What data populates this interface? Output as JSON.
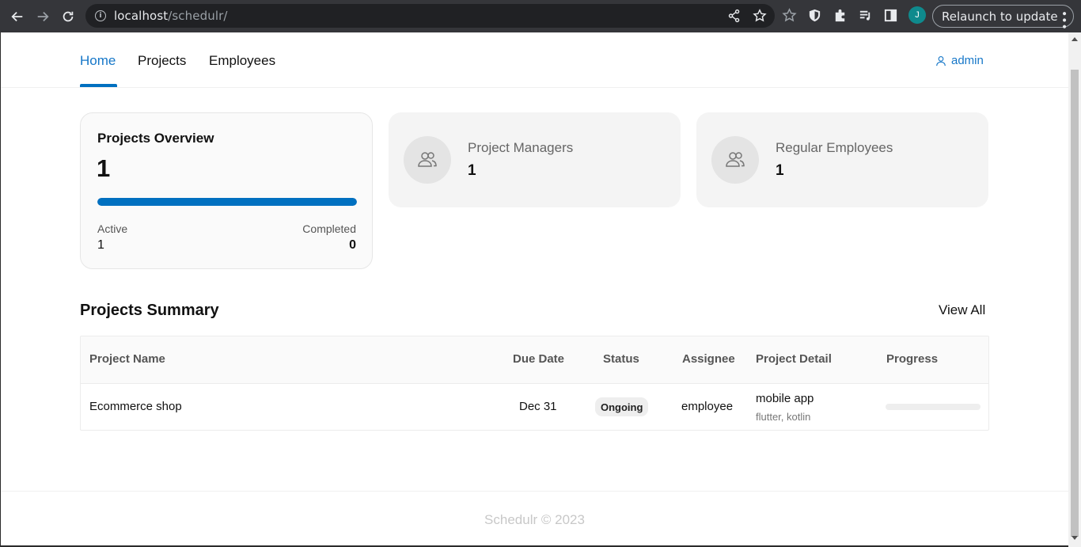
{
  "browser": {
    "url_host": "localhost",
    "url_path": "/schedulr/",
    "profile_initial": "J",
    "relaunch_label": "Relaunch to update"
  },
  "nav": {
    "items": [
      {
        "label": "Home",
        "active": true
      },
      {
        "label": "Projects",
        "active": false
      },
      {
        "label": "Employees",
        "active": false
      }
    ],
    "user": "admin"
  },
  "overview": {
    "title": "Projects Overview",
    "count": "1",
    "active_fraction": 1.0,
    "active_label": "Active",
    "active_value": "1",
    "completed_label": "Completed",
    "completed_value": "0"
  },
  "stats": [
    {
      "label": "Project Managers",
      "value": "1"
    },
    {
      "label": "Regular Employees",
      "value": "1"
    }
  ],
  "summary": {
    "title": "Projects Summary",
    "view_all": "View All",
    "columns": [
      "Project Name",
      "Due Date",
      "Status",
      "Assignee",
      "Project Detail",
      "Progress"
    ],
    "rows": [
      {
        "name": "Ecommerce shop",
        "due": "Dec 31",
        "status": "Ongoing",
        "assignee": "employee",
        "detail": "mobile app",
        "detail_sub": "flutter, kotlin",
        "progress": 0
      }
    ]
  },
  "footer": {
    "text": "Schedulr © 2023"
  },
  "colors": {
    "accent": "#0070c0",
    "link": "#1677c8",
    "chrome_bg": "#35363a"
  }
}
